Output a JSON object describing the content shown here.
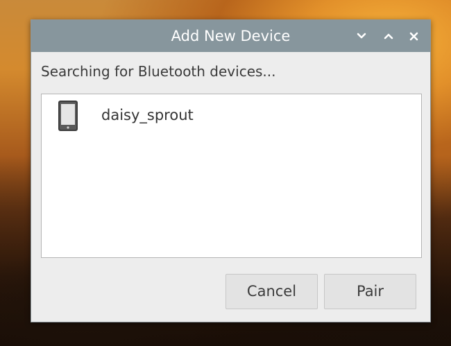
{
  "window": {
    "title": "Add New Device",
    "controls": [
      "chevron-down-icon",
      "chevron-up-icon",
      "close-icon"
    ]
  },
  "status_text": "Searching for Bluetooth devices...",
  "devices": [
    {
      "name": "daisy_sprout",
      "icon": "phone-icon"
    }
  ],
  "buttons": {
    "cancel": "Cancel",
    "pair": "Pair"
  },
  "colors": {
    "titlebar": "#87969d",
    "dialog_bg": "#ededed",
    "list_bg": "#ffffff",
    "button_bg": "#e3e3e3"
  }
}
